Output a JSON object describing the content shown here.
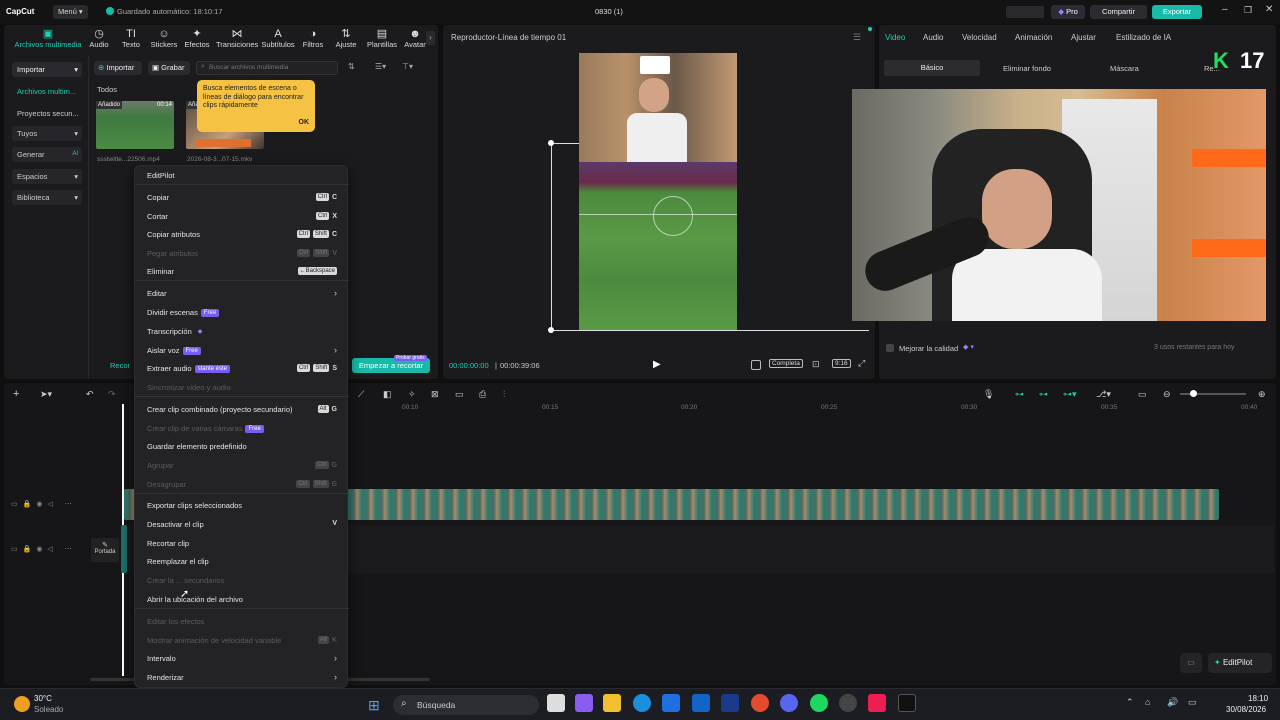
{
  "titlebar": {
    "app": "CapCut",
    "menu": "Menú",
    "autosave": "Guardado automático: 18:10:17",
    "project": "0830 (1)",
    "pro": "Pro",
    "share": "Compartir",
    "export": "Exportar"
  },
  "toolbar": {
    "tabs": [
      "Archivos multimedia",
      "Audio",
      "Texto",
      "Stickers",
      "Efectos",
      "Transiciones",
      "Subtítulos",
      "Filtros",
      "Ajuste",
      "Plantillas",
      "Avatar"
    ]
  },
  "sidebar": {
    "import": "Importar",
    "items": [
      "Archivos multim...",
      "Proyectos secun...",
      "Tuyos",
      "Generar",
      "Espacios",
      "Biblioteca"
    ],
    "ai_badge": "AI"
  },
  "media": {
    "import_btn": "Importar",
    "record_btn": "Grabar",
    "search_placeholder": "Buscar archivos multimedia",
    "all": "Todos",
    "clip1_tag": "Añadido",
    "clip1_dur": "00:14",
    "clip1_name": "ssstwitte...22506.mp4",
    "clip2_tag": "Añadido",
    "clip2_name": "2026-08-3...07-15.mkv",
    "tooltip": "Busca elementos de escena o líneas de diálogo para encontrar clips rápidamente",
    "tooltip_ok": "OK",
    "record_cut": "Recor",
    "start_cut": "Empezar a recortar",
    "try_free": "Probar gratis"
  },
  "player": {
    "title": "Reproductor-Línea de tiempo 01",
    "time_current": "00:00:00:00",
    "time_total": "00:00:39:06",
    "full": "Completa",
    "ratio": "9:16"
  },
  "inspector": {
    "tabs": [
      "Video",
      "Audio",
      "Velocidad",
      "Animación",
      "Ajustar",
      "Estilizado de IA"
    ],
    "subtabs": [
      "Básico",
      "Eliminar fondo",
      "Máscara",
      "Re..."
    ],
    "quality": "Mejorar la calidad",
    "uses": "3 usos restantes para hoy",
    "score": "17"
  },
  "timeline": {
    "ticks": [
      "00:10",
      "00:15",
      "00:20",
      "00:25",
      "00:30",
      "00:35",
      "00:40"
    ],
    "cover": "Portada",
    "editpilot": "EditPilot"
  },
  "context_menu": {
    "items": [
      {
        "label": "EditPilot"
      },
      {
        "label": "Copiar",
        "keys": [
          "Ctrl",
          "C"
        ]
      },
      {
        "label": "Cortar",
        "keys": [
          "Ctrl",
          "X"
        ]
      },
      {
        "label": "Copiar atributos",
        "keys": [
          "Ctrl",
          "Shift",
          "C"
        ]
      },
      {
        "label": "Pegar atributos",
        "keys": [
          "Ctrl",
          "Shift",
          "V"
        ],
        "disabled": true
      },
      {
        "label": "Eliminar",
        "keys": [
          "←Backspace"
        ]
      },
      {
        "label": "Editar",
        "submenu": true
      },
      {
        "label": "Dividir escenas",
        "badge": "Free"
      },
      {
        "label": "Transcripción",
        "badge": "◆"
      },
      {
        "label": "Aislar voz",
        "badge": "Free",
        "submenu": true
      },
      {
        "label": "Extraer audio",
        "badge": "stante este",
        "keys": [
          "Ctrl",
          "Shift",
          "S"
        ]
      },
      {
        "label": "Sincronizar video y audio",
        "disabled": true
      },
      {
        "label": "Crear clip combinado (proyecto secundario)",
        "keys": [
          "Alt",
          "G"
        ]
      },
      {
        "label": "Crear clip de varias cámaras",
        "badge": "Free",
        "disabled": true
      },
      {
        "label": "Guardar elemento predefinido"
      },
      {
        "label": "Agrupar",
        "keys": [
          "Ctrl",
          "G"
        ],
        "disabled": true
      },
      {
        "label": "Desagrupar",
        "keys": [
          "Ctrl",
          "Shift",
          "G"
        ],
        "disabled": true
      },
      {
        "label": "Exportar clips seleccionados"
      },
      {
        "label": "Desactivar el clip",
        "keys": [
          "V"
        ]
      },
      {
        "label": "Recortar clip"
      },
      {
        "label": "Reemplazar el clip"
      },
      {
        "label": "Crear la ... secundarios",
        "disabled": true
      },
      {
        "label": "Abrir la ubicación del archivo"
      },
      {
        "label": "Editar los efectos",
        "disabled": true
      },
      {
        "label": "Mostrar animación de velocidad variable",
        "keys": [
          "Alt",
          "K"
        ],
        "disabled": true
      },
      {
        "label": "Intervalo",
        "submenu": true
      },
      {
        "label": "Renderizar",
        "submenu": true
      }
    ]
  },
  "taskbar": {
    "temp": "30°C",
    "weather": "Soleado",
    "search": "Búsqueda",
    "time": "18:10",
    "date": "30/08/2026"
  }
}
